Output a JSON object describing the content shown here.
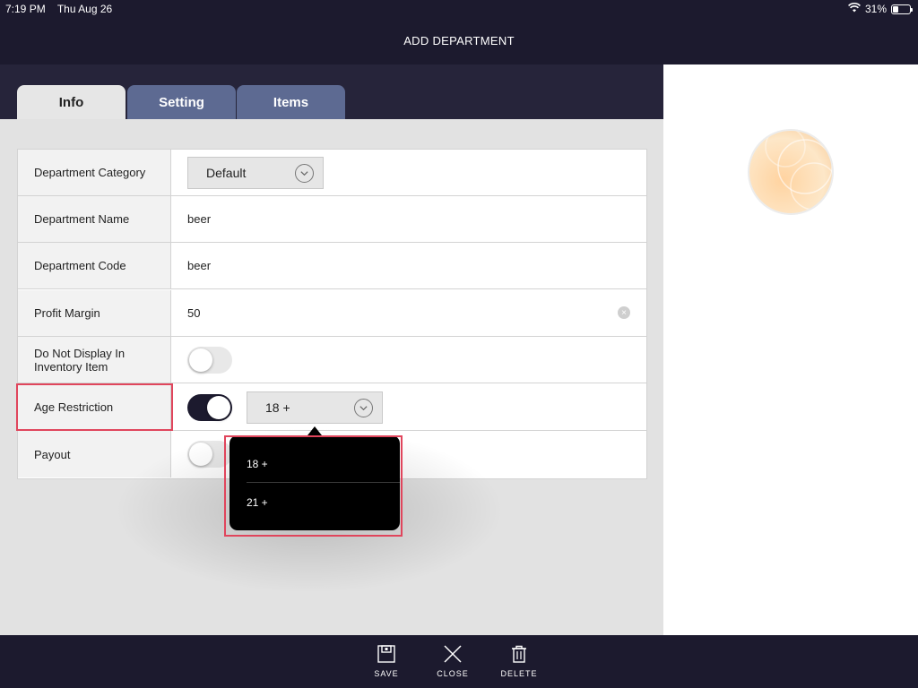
{
  "status_bar": {
    "time": "7:19 PM",
    "date": "Thu Aug 26",
    "battery": "31%",
    "battery_level": 0.31
  },
  "header": {
    "title": "ADD DEPARTMENT"
  },
  "tabs": [
    {
      "label": "Info",
      "active": true
    },
    {
      "label": "Setting",
      "active": false
    },
    {
      "label": "Items",
      "active": false
    }
  ],
  "form": {
    "department_category": {
      "label": "Department Category",
      "value": "Default"
    },
    "department_name": {
      "label": "Department Name",
      "value": "beer"
    },
    "department_code": {
      "label": "Department Code",
      "value": "beer"
    },
    "profit_margin": {
      "label": "Profit Margin",
      "value": "50"
    },
    "do_not_display": {
      "label_line1": "Do Not Display In",
      "label_line2": "Inventory Item",
      "enabled": false
    },
    "age_restriction": {
      "label": "Age Restriction",
      "enabled": true,
      "value": "18 +"
    },
    "payout": {
      "label": "Payout",
      "enabled": false
    }
  },
  "age_dropdown": {
    "options": [
      "18 +",
      "21 +"
    ]
  },
  "toolbar": {
    "save_label": "SAVE",
    "close_label": "CLOSE",
    "delete_label": "DELETE"
  },
  "colors": {
    "header_bg": "#1c1a2e",
    "tab_inactive": "#5d6a92",
    "annotation_red": "#e0455c"
  }
}
